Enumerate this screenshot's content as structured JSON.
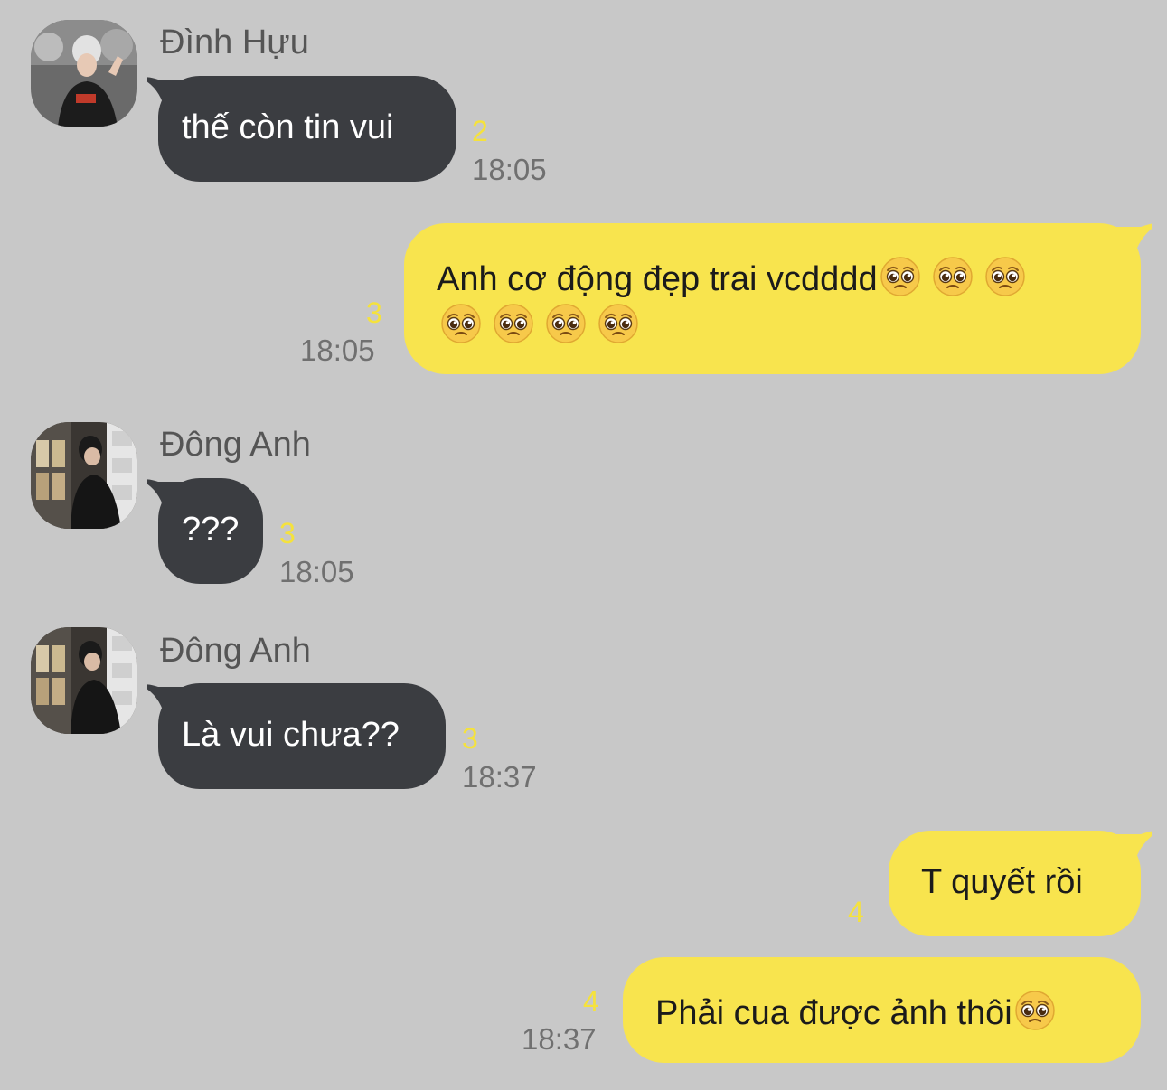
{
  "messages": [
    {
      "sender": "Đình Hựu",
      "text": "thế còn tin vui",
      "read_count": "2",
      "time": "18:05",
      "direction": "incoming"
    },
    {
      "text": "Anh cơ động đẹp trai vcdddd",
      "emoji": "pleading-face-emoji",
      "emoji_count": 7,
      "read_count": "3",
      "time": "18:05",
      "direction": "outgoing"
    },
    {
      "sender": "Đông Anh",
      "text": "???",
      "read_count": "3",
      "time": "18:05",
      "direction": "incoming"
    },
    {
      "sender": "Đông Anh",
      "text": "Là vui chưa??",
      "read_count": "3",
      "time": "18:37",
      "direction": "incoming"
    },
    {
      "text": "T quyết rồi",
      "read_count": "4",
      "direction": "outgoing"
    },
    {
      "text": "Phải cua được ảnh thôi",
      "emoji": "pleading-face-emoji",
      "emoji_count": 1,
      "read_count": "4",
      "time": "18:37",
      "direction": "outgoing"
    }
  ],
  "colors": {
    "background": "#c8c8c8",
    "incoming_bubble": "#3b3d41",
    "outgoing_bubble": "#f8e44e",
    "read_count": "#f5e23c",
    "time": "#707070",
    "sender_name": "#555555"
  }
}
